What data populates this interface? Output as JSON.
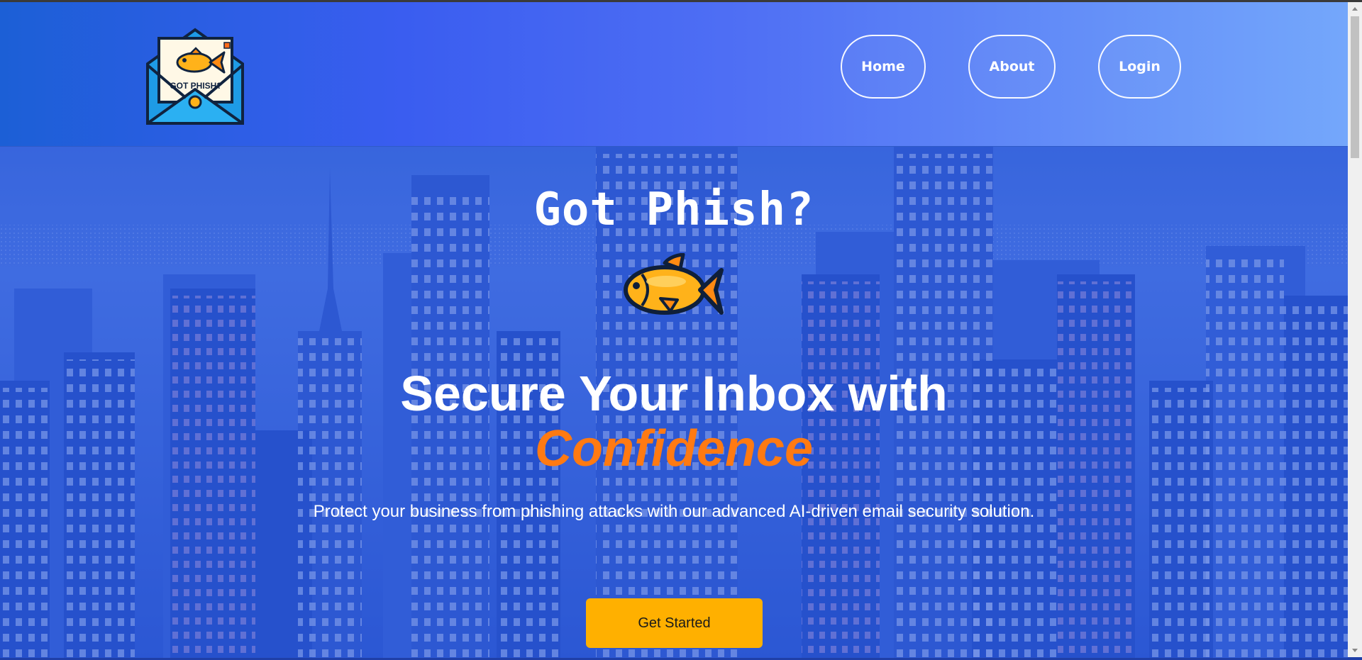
{
  "header": {
    "logo_text": "GOT PHISH?",
    "nav": [
      {
        "label": "Home"
      },
      {
        "label": "About"
      },
      {
        "label": "Login"
      }
    ]
  },
  "hero": {
    "title": "Got Phish?",
    "headline": "Secure Your Inbox with",
    "headline_accent": "Confidence",
    "subtext": "Protect your business from phishing attacks with our advanced AI-driven email security solution.",
    "cta_label": "Get Started"
  },
  "colors": {
    "header_gradient_start": "#1c5fd6",
    "header_gradient_end": "#74a7fb",
    "accent_orange": "#ff7a12",
    "cta_yellow": "#ffb000",
    "hero_blue": "#2a55d6"
  },
  "icons": [
    "envelope-fish-logo",
    "goldfish-icon"
  ]
}
